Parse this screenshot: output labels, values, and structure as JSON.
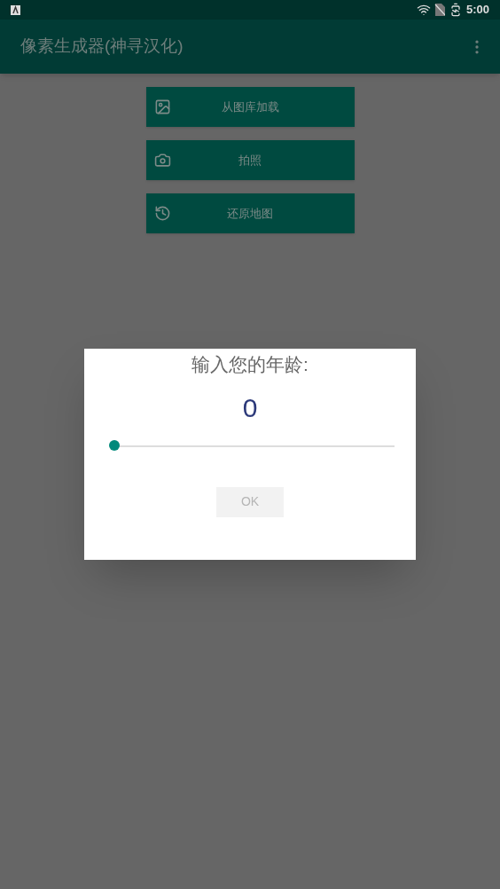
{
  "status_bar": {
    "time": "5:00"
  },
  "app_bar": {
    "title": "像素生成器(神寻汉化)"
  },
  "buttons": [
    {
      "label": "从图库加载"
    },
    {
      "label": "拍照"
    },
    {
      "label": "还原地图"
    }
  ],
  "dialog": {
    "title": "输入您的年龄:",
    "value": "0",
    "slider": {
      "level": 0
    },
    "ok": {
      "label": "OK",
      "disabled": true
    }
  }
}
